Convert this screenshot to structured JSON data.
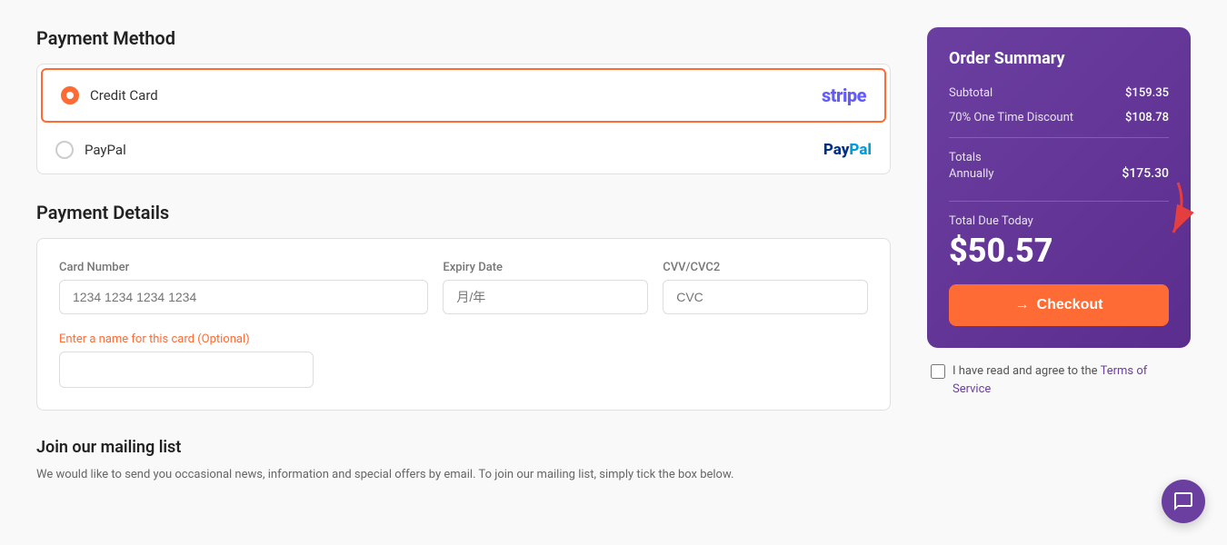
{
  "page": {
    "payment_method_title": "Payment Method",
    "payment_details_title": "Payment Details",
    "mailing_title": "Join our mailing list",
    "mailing_text": "We would like to send you occasional news, information and special offers by email. To join our mailing list, simply tick the box below."
  },
  "payment_options": [
    {
      "id": "credit-card",
      "label": "Credit Card",
      "logo": "stripe",
      "selected": true
    },
    {
      "id": "paypal",
      "label": "PayPal",
      "logo": "paypal",
      "selected": false
    }
  ],
  "form": {
    "card_number_label": "Card Number",
    "card_number_placeholder": "1234 1234 1234 1234",
    "expiry_label": "Expiry Date",
    "expiry_placeholder": "月/年",
    "cvv_label": "CVV/CVC2",
    "cvv_placeholder": "CVC",
    "name_label": "Enter a name for this card (Optional)"
  },
  "order_summary": {
    "title": "Order Summary",
    "subtotal_label": "Subtotal",
    "subtotal_value": "$159.35",
    "discount_label": "70% One Time Discount",
    "discount_value": "$108.78",
    "totals_label": "Totals",
    "totals_annually_label": "Annually",
    "totals_annually_value": "$175.30",
    "total_due_label": "Total Due Today",
    "total_due_amount": "$50.57",
    "checkout_label": "Checkout"
  },
  "terms": {
    "text": "I have read and agree to the",
    "link_text": "Terms of Service"
  },
  "icons": {
    "arrow_right": "→",
    "chat": "💬"
  }
}
